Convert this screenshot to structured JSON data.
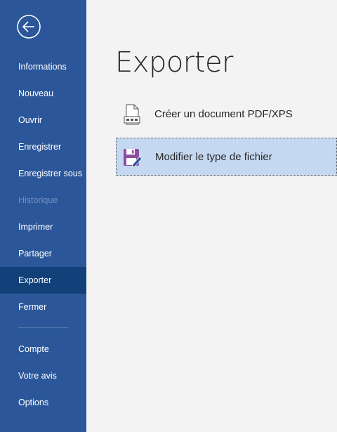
{
  "sidebar": {
    "back_icon": "back-arrow-icon",
    "items": [
      {
        "label": "Informations"
      },
      {
        "label": "Nouveau"
      },
      {
        "label": "Ouvrir"
      },
      {
        "label": "Enregistrer"
      },
      {
        "label": "Enregistrer sous"
      },
      {
        "label": "Historique",
        "disabled": true
      },
      {
        "label": "Imprimer"
      },
      {
        "label": "Partager"
      },
      {
        "label": "Exporter",
        "active": true
      },
      {
        "label": "Fermer"
      },
      {
        "label": "Compte"
      },
      {
        "label": "Votre avis"
      },
      {
        "label": "Options"
      }
    ]
  },
  "main": {
    "title": "Exporter",
    "options": [
      {
        "label": "Créer un document PDF/XPS",
        "icon": "pdf-document-icon"
      },
      {
        "label": "Modifier le type de fichier",
        "icon": "save-edit-icon",
        "selected": true
      }
    ]
  },
  "colors": {
    "sidebar_bg": "#2b579a",
    "sidebar_active": "#124078",
    "selected_bg": "#c5d8f1",
    "main_bg": "#f3f3f3"
  }
}
